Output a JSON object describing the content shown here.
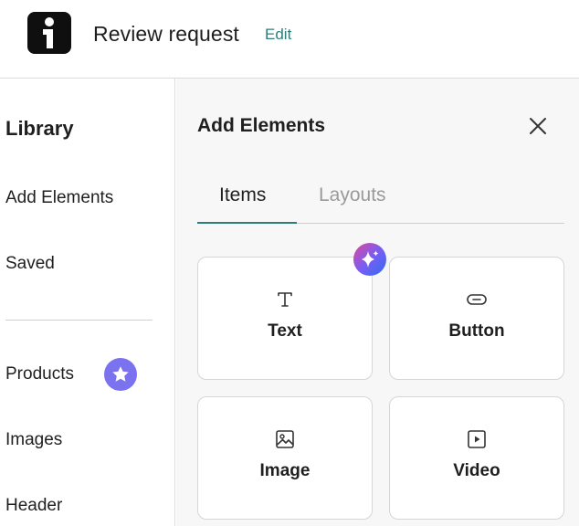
{
  "header": {
    "logo_icon": "i-logo-icon",
    "title": "Review request",
    "edit_label": "Edit"
  },
  "sidebar": {
    "title": "Library",
    "items": [
      {
        "label": "Add Elements"
      },
      {
        "label": "Saved"
      },
      {
        "label": "Products",
        "badge_icon": "star-icon"
      },
      {
        "label": "Images"
      },
      {
        "label": "Header"
      }
    ]
  },
  "panel": {
    "title": "Add Elements",
    "close_icon": "close-icon",
    "tabs": [
      {
        "label": "Items",
        "active": true
      },
      {
        "label": "Layouts",
        "active": false
      }
    ],
    "cards": [
      {
        "label": "Text",
        "icon": "text-icon",
        "badge_icon": "ai-sparkle-icon"
      },
      {
        "label": "Button",
        "icon": "button-icon"
      },
      {
        "label": "Image",
        "icon": "image-icon"
      },
      {
        "label": "Video",
        "icon": "video-icon"
      }
    ]
  },
  "colors": {
    "accent": "#2e7d79",
    "star_badge": "#7b72f0",
    "panel_bg": "#f6f7f6"
  }
}
